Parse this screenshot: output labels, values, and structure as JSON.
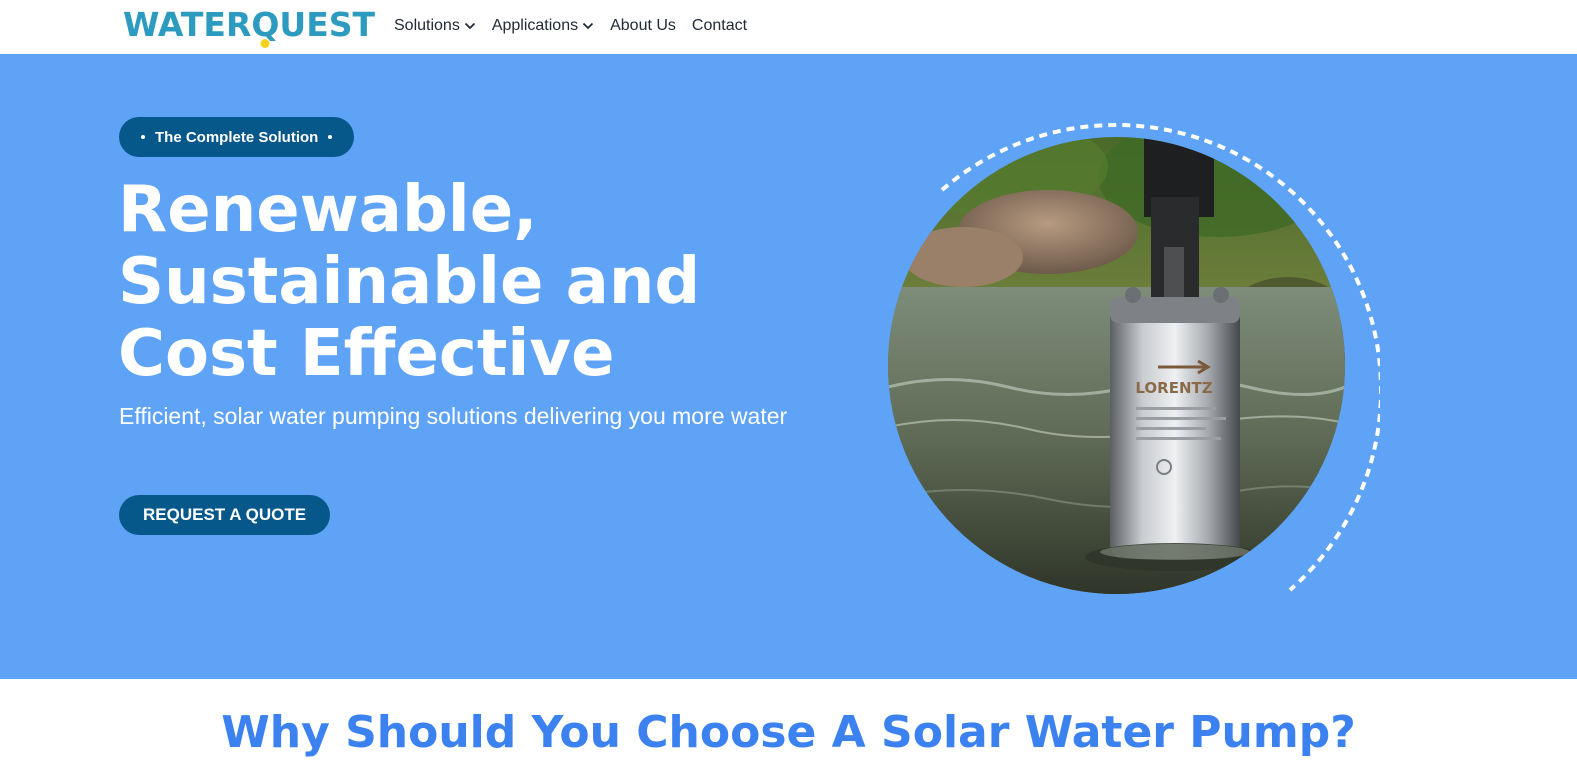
{
  "brand": {
    "logo_text_before": "WATER",
    "logo_q": "Q",
    "logo_text_after": "UEST",
    "primary_color": "#2d9bbf",
    "accent_yellow": "#f4d21d"
  },
  "nav": {
    "items": [
      {
        "label": "Solutions",
        "has_dropdown": true
      },
      {
        "label": "Applications",
        "has_dropdown": true
      },
      {
        "label": "About Us",
        "has_dropdown": false
      },
      {
        "label": "Contact",
        "has_dropdown": false
      }
    ]
  },
  "hero": {
    "background_color": "#5fa3f7",
    "badge_label": "The Complete Solution",
    "headline_lines": [
      "Renewable,",
      "Sustainable and",
      "Cost Effective"
    ],
    "subtitle": "Efficient, solar water pumping solutions delivering you more water",
    "cta_label": "REQUEST A QUOTE",
    "button_color": "#07588a",
    "pump_brand_text": "LORENTZ"
  },
  "why": {
    "title": "Why Should You Choose A Solar Water Pump?",
    "title_color": "#3b82f0"
  }
}
